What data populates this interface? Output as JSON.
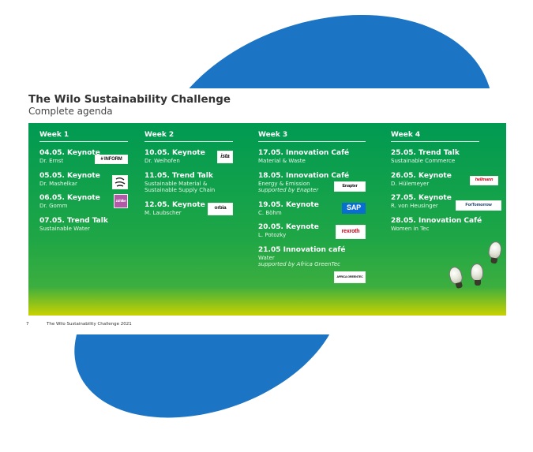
{
  "slide": {
    "title": "The Wilo Sustainability Challenge",
    "subtitle": "Complete agenda",
    "footer_number": "7",
    "footer_text": "The Wilo Sustainability Challenge 2021"
  },
  "weeks": [
    {
      "heading": "Week 1",
      "entries": [
        {
          "head": "04.05. Keynote",
          "sub": [
            "Dr. Ernst"
          ],
          "logo": "# INFORM"
        },
        {
          "head": "05.05. Keynote",
          "sub": [
            "Dr. Mashelkar"
          ],
          "logo": "emblem"
        },
        {
          "head": "06.05. Keynote",
          "sub": [
            "Dr. Gomm"
          ],
          "logo": "zühlke"
        },
        {
          "head": "07.05. Trend Talk",
          "sub": [
            "Sustainable Water"
          ],
          "logo": ""
        }
      ]
    },
    {
      "heading": "Week 2",
      "entries": [
        {
          "head": "10.05. Keynote",
          "sub": [
            "Dr. Weihofen"
          ],
          "logo": "ista"
        },
        {
          "head": "11.05. Trend Talk",
          "sub": [
            "Sustainable Material &",
            "Sustainable Supply Chain"
          ],
          "logo": ""
        },
        {
          "head": "12.05. Keynote",
          "sub": [
            "M. Laubscher"
          ],
          "logo": "orbia"
        }
      ]
    },
    {
      "heading": "Week 3",
      "entries": [
        {
          "head": "17.05. Innovation Café",
          "sub": [
            "Material & Waste"
          ],
          "logo": ""
        },
        {
          "head": "18.05. Innovation Café",
          "sub": [
            "Energy & Emission"
          ],
          "italic": "supported by Enapter",
          "logo": "Enapter"
        },
        {
          "head": "19.05. Keynote",
          "sub": [
            "C. Böhm"
          ],
          "logo": "SAP"
        },
        {
          "head": "20.05. Keynote",
          "sub": [
            "L. Potozky"
          ],
          "logo": "rexroth"
        },
        {
          "head": "21.05 Innovation café",
          "sub": [
            "Water"
          ],
          "italic": "supported by Africa GreenTec",
          "logo": "AFRICA GREENTEC"
        }
      ]
    },
    {
      "heading": "Week 4",
      "entries": [
        {
          "head": "25.05. Trend Talk",
          "sub": [
            "Sustainable Commerce"
          ],
          "logo": ""
        },
        {
          "head": "26.05. Keynote",
          "sub": [
            "D. Hülemeyer"
          ],
          "logo": "hellmann"
        },
        {
          "head": "27.05. Keynote",
          "sub": [
            "R. von Heusinger"
          ],
          "logo": "ForTomorrow"
        },
        {
          "head": "28.05. Innovation Café",
          "sub": [
            "Women in Tec"
          ],
          "logo": ""
        }
      ]
    }
  ],
  "colors": {
    "blob": "#1b74c4",
    "panel_green": "#009a52",
    "panel_yellow": "#c9d100"
  }
}
